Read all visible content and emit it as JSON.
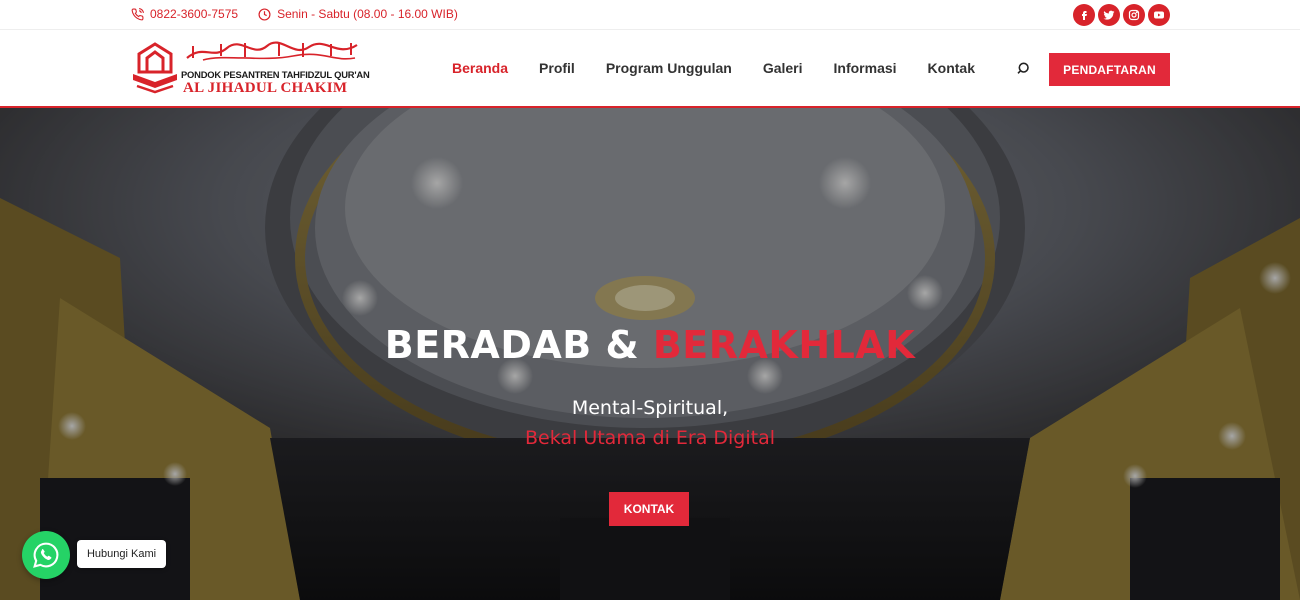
{
  "topbar": {
    "phone": "0822-3600-7575",
    "hours": "Senin - Sabtu (08.00 - 16.00 WIB)",
    "socials": [
      "facebook-icon",
      "twitter-icon",
      "instagram-icon",
      "youtube-icon"
    ]
  },
  "logo": {
    "arabic": "المعهد تحفيظ القرآن الجهاد الحكيم",
    "line1": "PONDOK PESANTREN TAHFIDZUL QUR'AN",
    "line2": "AL JIHADUL CHAKIM"
  },
  "nav": {
    "items": [
      {
        "label": "Beranda",
        "active": true
      },
      {
        "label": "Profil",
        "active": false
      },
      {
        "label": "Program Unggulan",
        "active": false
      },
      {
        "label": "Galeri",
        "active": false
      },
      {
        "label": "Informasi",
        "active": false
      },
      {
        "label": "Kontak",
        "active": false
      }
    ],
    "cta": "PENDAFTARAN"
  },
  "hero": {
    "headline_white": "BERADAB & ",
    "headline_accent": "BERAKHLAK",
    "sub1": "Mental-Spiritual,",
    "sub2": "Bekal Utama di Era Digital",
    "button": "KONTAK"
  },
  "whatsapp": {
    "label": "Hubungi Kami"
  },
  "colors": {
    "accent": "#e2293a",
    "whatsapp": "#25d366"
  }
}
